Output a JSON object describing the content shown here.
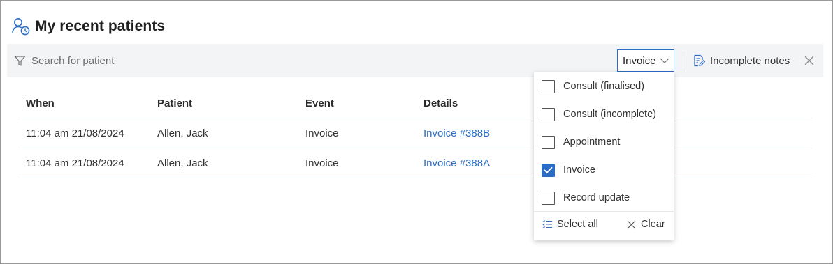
{
  "header": {
    "title": "My recent patients",
    "icon": "patient-clock-icon"
  },
  "toolbar": {
    "search_placeholder": "Search for patient",
    "event_filter_value": "Invoice",
    "incomplete_notes_label": "Incomplete notes"
  },
  "table": {
    "columns": [
      "When",
      "Patient",
      "Event",
      "Details"
    ],
    "rows": [
      {
        "when": "11:04 am 21/08/2024",
        "patient": "Allen, Jack",
        "event": "Invoice",
        "details": "Invoice #388B"
      },
      {
        "when": "11:04 am 21/08/2024",
        "patient": "Allen, Jack",
        "event": "Invoice",
        "details": "Invoice #388A"
      }
    ]
  },
  "dropdown": {
    "options": [
      {
        "label": "Consult (finalised)",
        "checked": false
      },
      {
        "label": "Consult (incomplete)",
        "checked": false
      },
      {
        "label": "Appointment",
        "checked": false
      },
      {
        "label": "Invoice",
        "checked": true
      },
      {
        "label": "Record update",
        "checked": false
      }
    ],
    "select_all_label": "Select all",
    "clear_label": "Clear"
  },
  "colors": {
    "accent": "#2b6cc4",
    "toolbar_bg": "#f3f4f5",
    "row_border": "#dfe7ea"
  }
}
